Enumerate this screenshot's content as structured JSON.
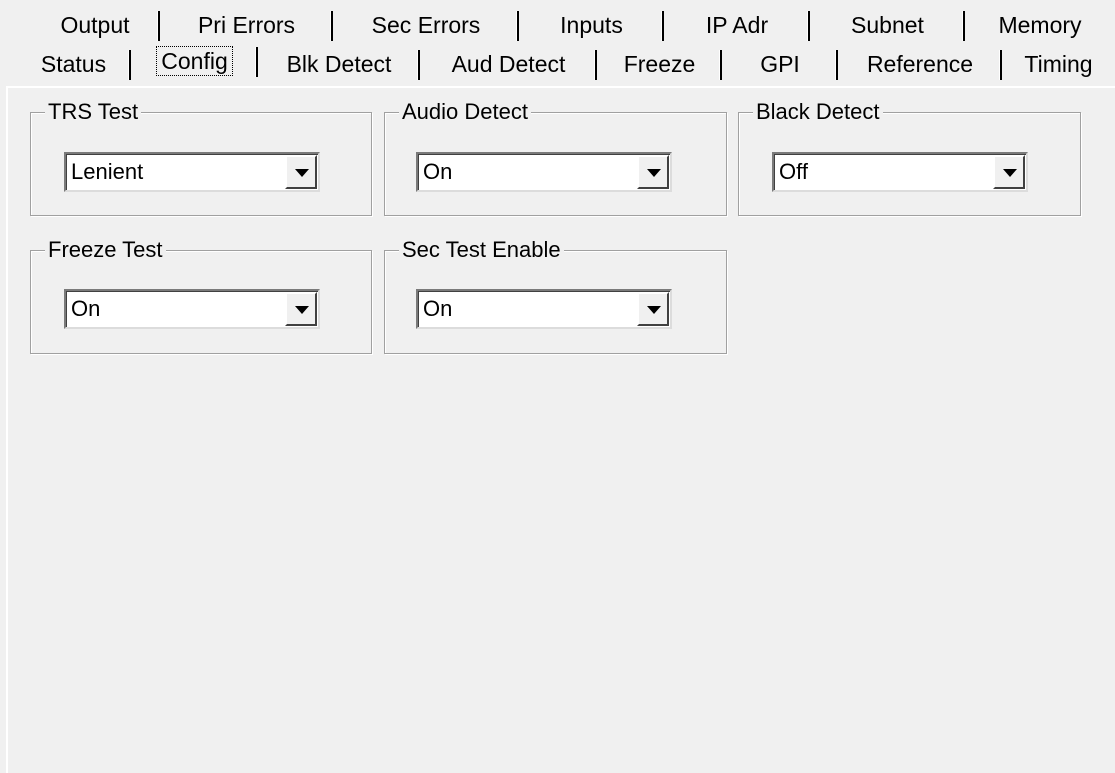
{
  "tabs": {
    "back_row": [
      {
        "label": "Output"
      },
      {
        "label": "Pri Errors"
      },
      {
        "label": "Sec Errors"
      },
      {
        "label": "Inputs"
      },
      {
        "label": "IP Adr"
      },
      {
        "label": "Subnet"
      },
      {
        "label": "Memory"
      }
    ],
    "front_row": [
      {
        "label": "Status"
      },
      {
        "label": "Config",
        "selected": true
      },
      {
        "label": "Blk Detect"
      },
      {
        "label": "Aud Detect"
      },
      {
        "label": "Freeze"
      },
      {
        "label": "GPI"
      },
      {
        "label": "Reference"
      },
      {
        "label": "Timing"
      }
    ]
  },
  "config": {
    "trs_test": {
      "label": "TRS Test",
      "value": "Lenient"
    },
    "audio_detect": {
      "label": "Audio Detect",
      "value": "On"
    },
    "black_detect": {
      "label": "Black Detect",
      "value": "Off"
    },
    "freeze_test": {
      "label": "Freeze Test",
      "value": "On"
    },
    "sec_test_enable": {
      "label": "Sec Test Enable",
      "value": "On"
    }
  },
  "icons": {
    "dropdown": "chevron-down-icon"
  }
}
